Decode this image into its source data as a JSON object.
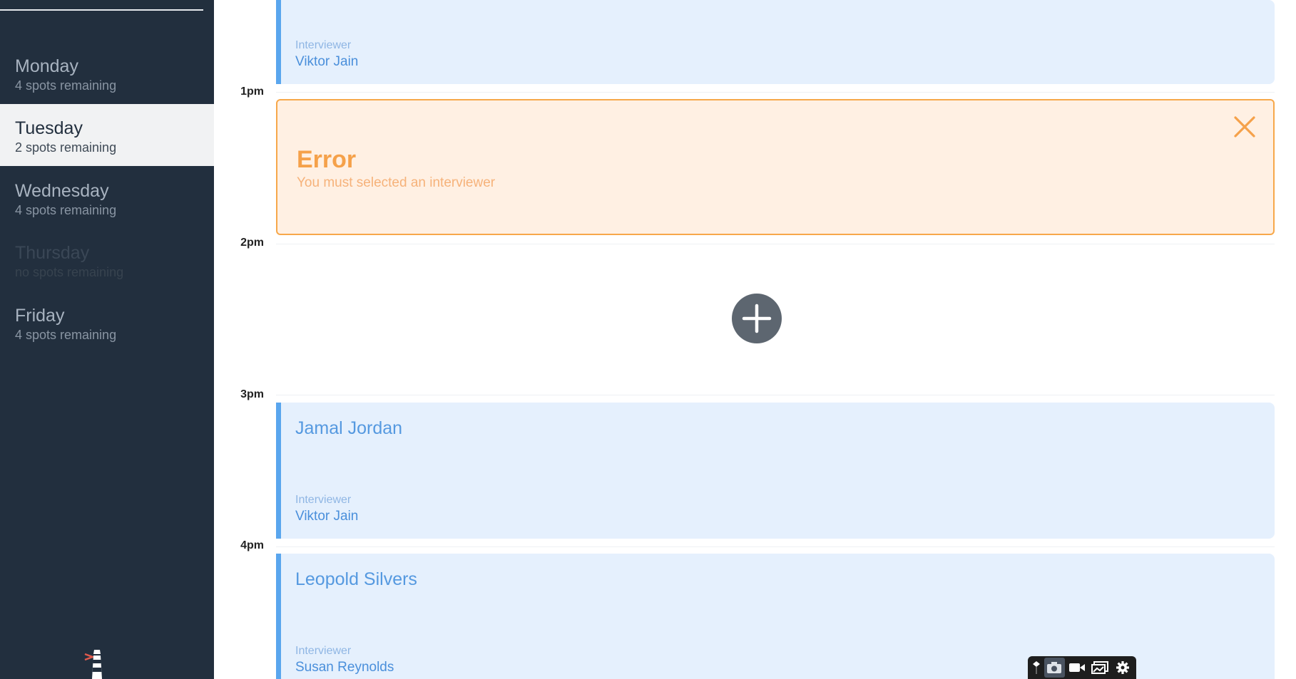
{
  "sidebar": {
    "days": [
      {
        "name": "Monday",
        "spots": "4 spots remaining"
      },
      {
        "name": "Tuesday",
        "spots": "2 spots remaining"
      },
      {
        "name": "Wednesday",
        "spots": "4 spots remaining"
      },
      {
        "name": "Thursday",
        "spots": "no spots remaining"
      },
      {
        "name": "Friday",
        "spots": "4 spots remaining"
      }
    ],
    "selected_day": "Tuesday",
    "logo_icon": "lighthouse-icon"
  },
  "schedule": {
    "times": [
      "1pm",
      "2pm",
      "3pm",
      "4pm"
    ],
    "appointments": [
      {
        "student": "",
        "interviewer_label": "Interviewer",
        "interviewer": "Viktor Jain"
      },
      {
        "student": "Jamal Jordan",
        "interviewer_label": "Interviewer",
        "interviewer": "Viktor Jain"
      },
      {
        "student": "Leopold Silvers",
        "interviewer_label": "Interviewer",
        "interviewer": "Susan Reynolds"
      }
    ],
    "error": {
      "title": "Error",
      "message": "You must selected an interviewer"
    },
    "add_icon": "plus-icon"
  },
  "toolbar": {
    "icons": [
      "pin-icon",
      "camera-icon",
      "video-icon",
      "gallery-icon",
      "gear-icon"
    ]
  },
  "colors": {
    "sidebar_bg": "#222f3e",
    "appointment_bg": "#e5f0fd",
    "appointment_accent": "#5aa6ee",
    "error_bg": "#fff0e3",
    "error_accent": "#f7a84a"
  }
}
